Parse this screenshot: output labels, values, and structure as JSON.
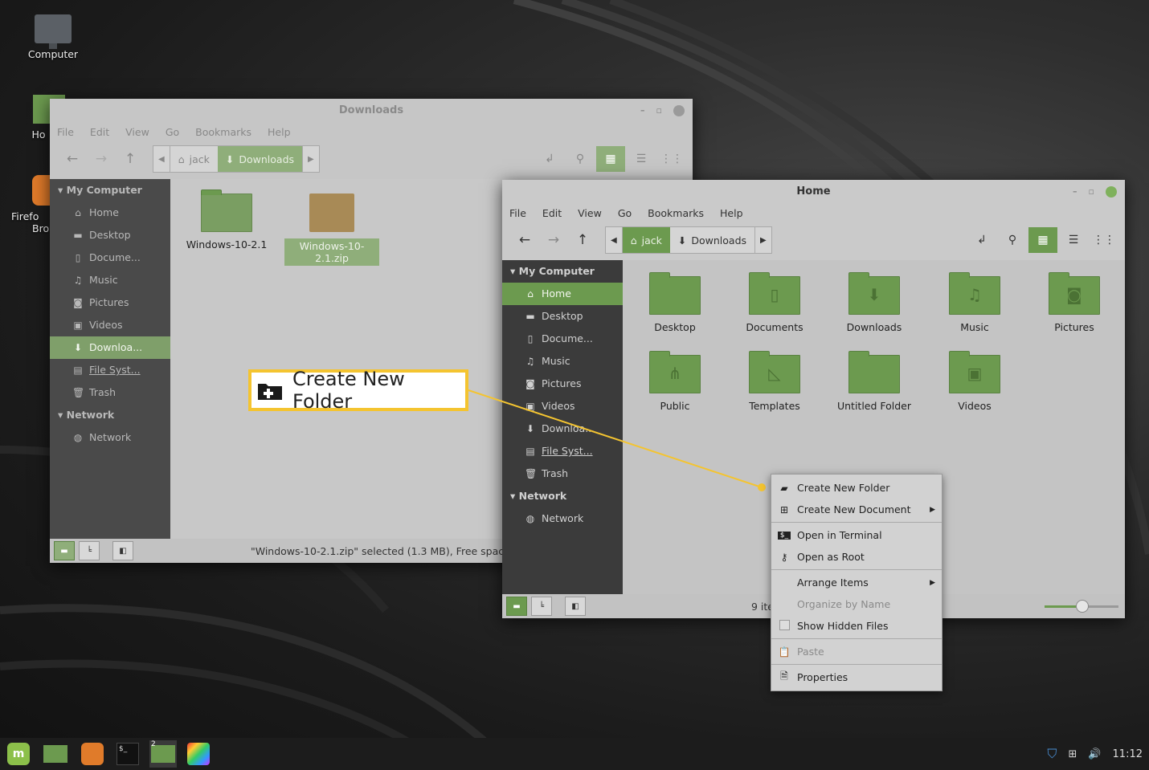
{
  "desktop": {
    "icons": [
      {
        "label": "Computer"
      },
      {
        "label": "Ho"
      },
      {
        "label": "Firefo"
      },
      {
        "label": "Bro"
      }
    ]
  },
  "back_window": {
    "title": "Downloads",
    "menu": [
      "File",
      "Edit",
      "View",
      "Go",
      "Bookmarks",
      "Help"
    ],
    "path": [
      "jack",
      "Downloads"
    ],
    "sidebar": {
      "sections": [
        {
          "title": "My Computer",
          "items": [
            "Home",
            "Desktop",
            "Docume...",
            "Music",
            "Pictures",
            "Videos",
            "Downloa...",
            "File Syst...",
            "Trash"
          ]
        },
        {
          "title": "Network",
          "items": [
            "Network"
          ]
        }
      ]
    },
    "files": [
      "Windows-10-2.1",
      "Windows-10-2.1.zip"
    ],
    "status": "\"Windows-10-2.1.zip\" selected (1.3 MB), Free space: 4.2 GB"
  },
  "front_window": {
    "title": "Home",
    "menu": [
      "File",
      "Edit",
      "View",
      "Go",
      "Bookmarks",
      "Help"
    ],
    "path": [
      "jack",
      "Downloads"
    ],
    "sidebar": {
      "sections": [
        {
          "title": "My Computer",
          "items": [
            "Home",
            "Desktop",
            "Docume...",
            "Music",
            "Pictures",
            "Videos",
            "Downloa...",
            "File Syst...",
            "Trash"
          ]
        },
        {
          "title": "Network",
          "items": [
            "Network"
          ]
        }
      ]
    },
    "folders": [
      "Desktop",
      "Documents",
      "Downloads",
      "Music",
      "Pictures",
      "Public",
      "Templates",
      "Untitled Folder",
      "Videos"
    ],
    "status": "9 ite",
    "zoom_level": 0.5
  },
  "context_menu": {
    "items": [
      {
        "label": "Create New Folder",
        "icon": "new-folder-icon"
      },
      {
        "label": "Create New Document",
        "icon": "new-document-icon",
        "submenu": true
      },
      {
        "label": "Open in Terminal",
        "icon": "terminal-icon"
      },
      {
        "label": "Open as Root",
        "icon": "key-icon"
      },
      {
        "label": "Arrange Items",
        "submenu": true
      },
      {
        "label": "Organize by Name",
        "disabled": true
      },
      {
        "label": "Show Hidden Files",
        "checkbox": true
      },
      {
        "label": "Paste",
        "icon": "paste-icon",
        "disabled": true
      },
      {
        "label": "Properties",
        "icon": "properties-icon"
      }
    ]
  },
  "callout": {
    "label": "Create New Folder"
  },
  "taskbar": {
    "workspace_badge": "2",
    "clock": "11:12"
  },
  "colors": {
    "accent": "#6c9a4f",
    "callout_border": "#f4c430"
  }
}
